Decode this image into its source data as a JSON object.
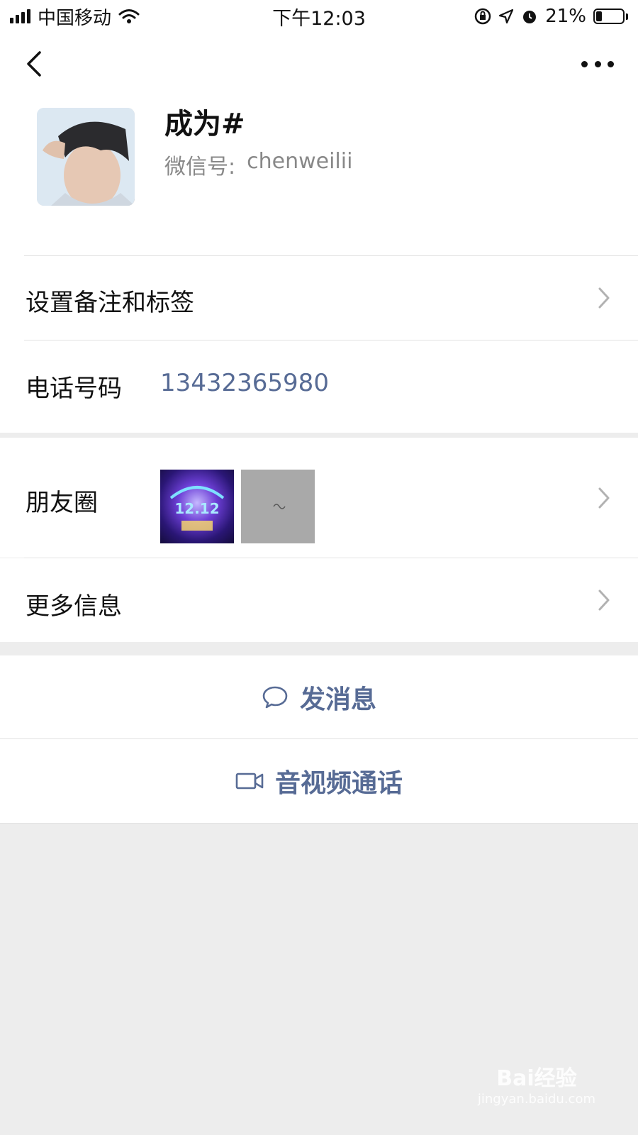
{
  "status_bar": {
    "carrier": "中国移动",
    "time": "下午12:03",
    "battery_percent": "21%",
    "battery_level": 0.21
  },
  "profile": {
    "name": "成为#",
    "wechat_id_label": "微信号:",
    "wechat_id": "chenweilii"
  },
  "rows": {
    "remark_label": "设置备注和标签",
    "phone_label": "电话号码",
    "phone_value": "13432365980",
    "moments_label": "朋友圈",
    "more_info_label": "更多信息"
  },
  "moments_thumbs": [
    {
      "caption": "12.12"
    },
    {
      "caption": ""
    }
  ],
  "actions": {
    "message_label": "发消息",
    "video_call_label": "音视频通话"
  },
  "watermark": {
    "brand": "Bai经验",
    "url": "jingyan.baidu.com"
  },
  "colors": {
    "link": "#576b95",
    "background": "#ededed"
  }
}
